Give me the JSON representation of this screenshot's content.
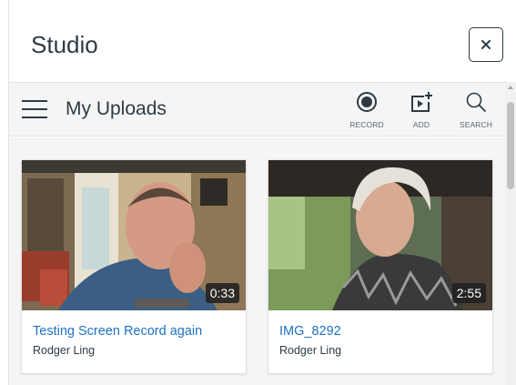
{
  "header": {
    "title": "Studio",
    "close_icon": "close-icon"
  },
  "toolbar": {
    "title": "My Uploads",
    "menu_icon": "hamburger-menu-icon",
    "actions": [
      {
        "label": "RECORD",
        "icon": "record-icon"
      },
      {
        "label": "ADD",
        "icon": "add-media-icon"
      },
      {
        "label": "SEARCH",
        "icon": "search-icon"
      }
    ]
  },
  "media": [
    {
      "title": "Testing Screen Record again",
      "owner": "Rodger Ling",
      "duration": "0:33"
    },
    {
      "title": "IMG_8292",
      "owner": "Rodger Ling",
      "duration": "2:55"
    }
  ],
  "colors": {
    "link": "#1f72c4",
    "text": "#2d3b45",
    "toolbar_bg": "#f5f5f5"
  }
}
